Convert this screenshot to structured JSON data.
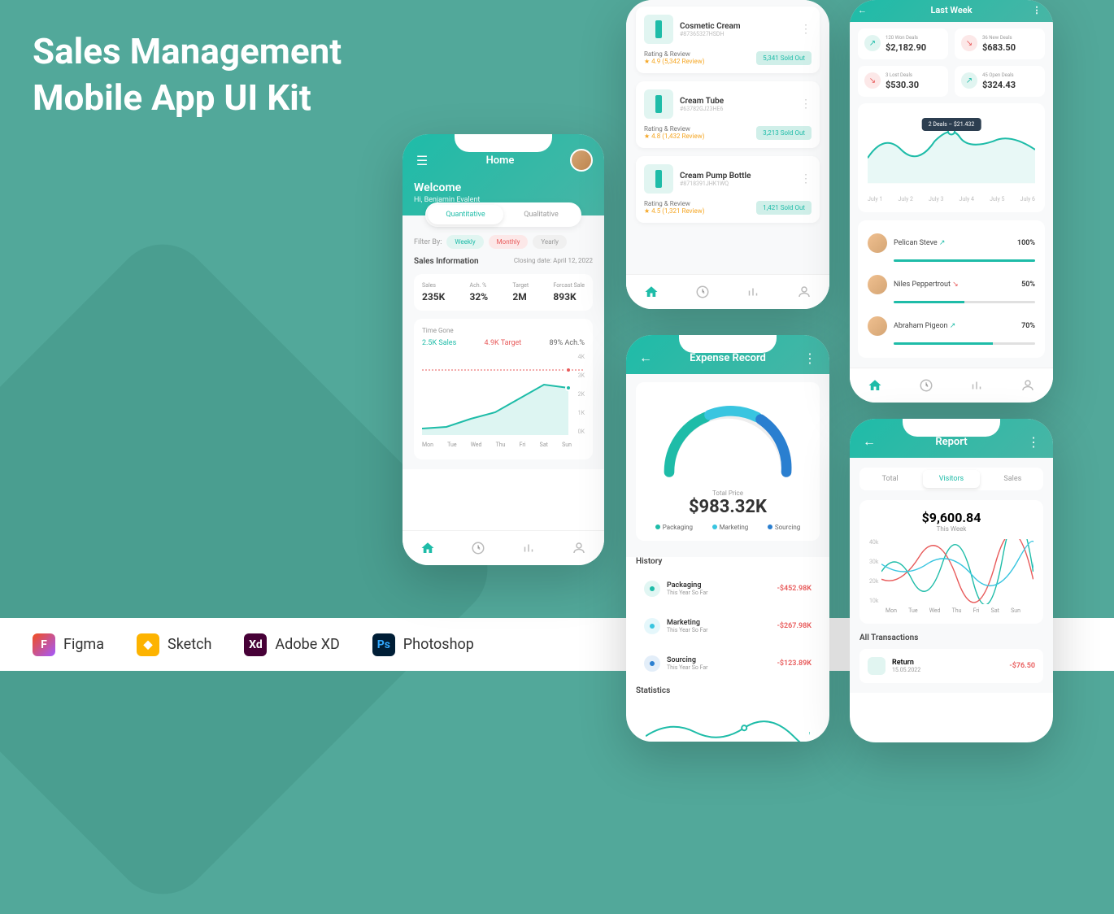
{
  "headline": {
    "line1": "Sales Management",
    "line2": "Mobile App UI Kit"
  },
  "tools": {
    "figma": "Figma",
    "sketch": "Sketch",
    "xd": "Adobe XD",
    "ps": "Photoshop"
  },
  "phone1": {
    "title": "Home",
    "welcome": "Welcome",
    "greeting": "Hi, Benjamin Evalent",
    "tabs": {
      "quant": "Quantitative",
      "qual": "Qualitative"
    },
    "filterLabel": "Filter By:",
    "chips": {
      "weekly": "Weekly",
      "monthly": "Monthly",
      "yearly": "Yearly"
    },
    "salesInfoTitle": "Sales Information",
    "closingDate": "Closing date: April 12, 2022",
    "stats": {
      "salesLabel": "Sales",
      "salesValue": "235K",
      "achLabel": "Ach. %",
      "achValue": "32%",
      "targetLabel": "Target",
      "targetValue": "2M",
      "forecastLabel": "Forcast Sale",
      "forecastValue": "893K"
    },
    "timeGone": "Time Gone",
    "timeRow": {
      "sales": "2.5K Sales",
      "target": "4.9K Target",
      "ach": "89% Ach.%"
    },
    "yAxis": [
      "4K",
      "3K",
      "2K",
      "1K",
      "0K"
    ],
    "xAxis": [
      "Mon",
      "Tue",
      "Wed",
      "Thu",
      "Fri",
      "Sat",
      "Sun"
    ]
  },
  "phone2": {
    "products": [
      {
        "name": "Cosmetic Cream",
        "sku": "#87365327HSDH",
        "ratingLabel": "Rating & Review",
        "rating": "★ 4.9 (5,342 Review)",
        "sold": "5,341 Sold Out"
      },
      {
        "name": "Cream Tube",
        "sku": "#63782GJ23HE6",
        "ratingLabel": "Rating & Review",
        "rating": "★ 4.8 (1,432 Review)",
        "sold": "3,213 Sold Out"
      },
      {
        "name": "Cream Pump Bottle",
        "sku": "#8718391JHK1WQ",
        "ratingLabel": "Rating & Review",
        "rating": "★ 4.5 (1,321 Review)",
        "sold": "1,421 Sold Out"
      }
    ]
  },
  "phone3": {
    "title": "Expense Record",
    "gaugeLabel": "Total Price",
    "gaugeValue": "$983.32K",
    "legend": {
      "pkg": "Packaging",
      "mkt": "Marketing",
      "src": "Sourcing"
    },
    "historyTitle": "History",
    "history": [
      {
        "name": "Packaging",
        "sub": "This Year So Far",
        "val": "-$452.98K",
        "color": "#1ebca8"
      },
      {
        "name": "Marketing",
        "sub": "This Year So Far",
        "val": "-$267.98K",
        "color": "#39c5e0"
      },
      {
        "name": "Sourcing",
        "sub": "This Year So Far",
        "val": "-$123.89K",
        "color": "#2a7fd0"
      }
    ],
    "statsTitle": "Statistics"
  },
  "phone4": {
    "title": "Last Week",
    "deals": [
      {
        "label": "120 Won Deals",
        "value": "$2,182.90",
        "dir": "up"
      },
      {
        "label": "36 New Deals",
        "value": "$683.50",
        "dir": "down"
      },
      {
        "label": "3 Lost Deals",
        "value": "$530.30",
        "dir": "down"
      },
      {
        "label": "45 Open Deals",
        "value": "$324.43",
        "dir": "up"
      }
    ],
    "tooltip": "2 Deals – $21.432",
    "dates": [
      "July 1",
      "July 2",
      "July 3",
      "July 4",
      "July 5",
      "July 6"
    ],
    "people": [
      {
        "name": "Pelican Steve",
        "pct": "100%",
        "dir": "up",
        "fill": 100
      },
      {
        "name": "Niles Peppertrout",
        "pct": "50%",
        "dir": "down",
        "fill": 50
      },
      {
        "name": "Abraham Pigeon",
        "pct": "70%",
        "dir": "up",
        "fill": 70
      }
    ]
  },
  "phone5": {
    "title": "Report",
    "tabs": {
      "total": "Total",
      "visitors": "Visitors",
      "sales": "Sales"
    },
    "chartValue": "$9,600.84",
    "chartSub": "This Week",
    "yAxis": [
      "40k",
      "30k",
      "20k",
      "10k"
    ],
    "xAxis": [
      "Mon",
      "Tue",
      "Wed",
      "Thu",
      "Fri",
      "Sat",
      "Sun"
    ],
    "transTitle": "All Transactions",
    "trans": {
      "name": "Return",
      "date": "15.05.2022",
      "val": "-$76.50"
    }
  }
}
